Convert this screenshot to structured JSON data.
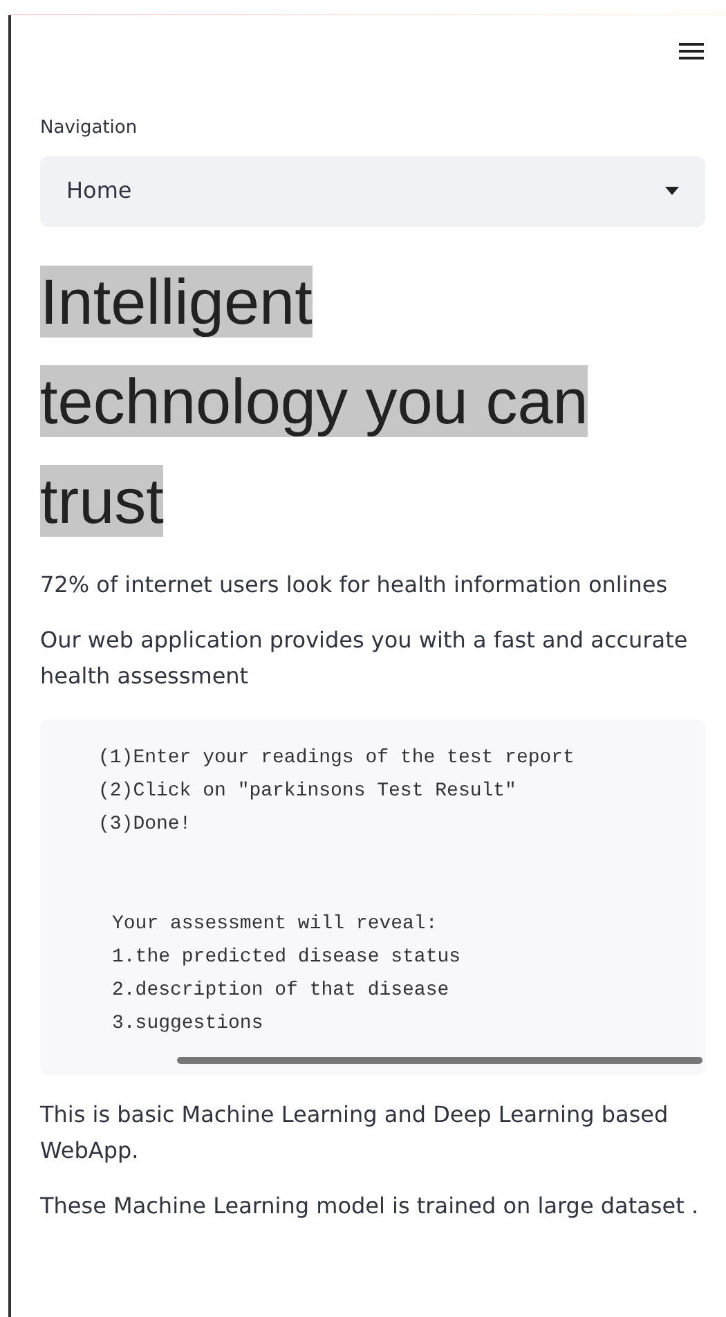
{
  "navigation": {
    "label": "Navigation",
    "value": "Home"
  },
  "heading_lines": [
    "Intelligent",
    "technology you can",
    "trust"
  ],
  "paragraphs_top": [
    "72% of internet users look for health information onlines",
    "Our web application provides you with a fast and accurate health assessment"
  ],
  "code_groups": [
    [
      "(1)Enter your readings of the test report",
      "(2)Click on \"parkinsons Test Result\"",
      "(3)Done!"
    ],
    [
      "Your assessment will reveal:",
      "1.the predicted disease status",
      "2.description of that disease",
      "3.suggestions"
    ]
  ],
  "paragraphs_bottom": [
    "This is basic Machine Learning and Deep Learning based WebApp.",
    "These Machine Learning model is trained on large dataset ."
  ]
}
